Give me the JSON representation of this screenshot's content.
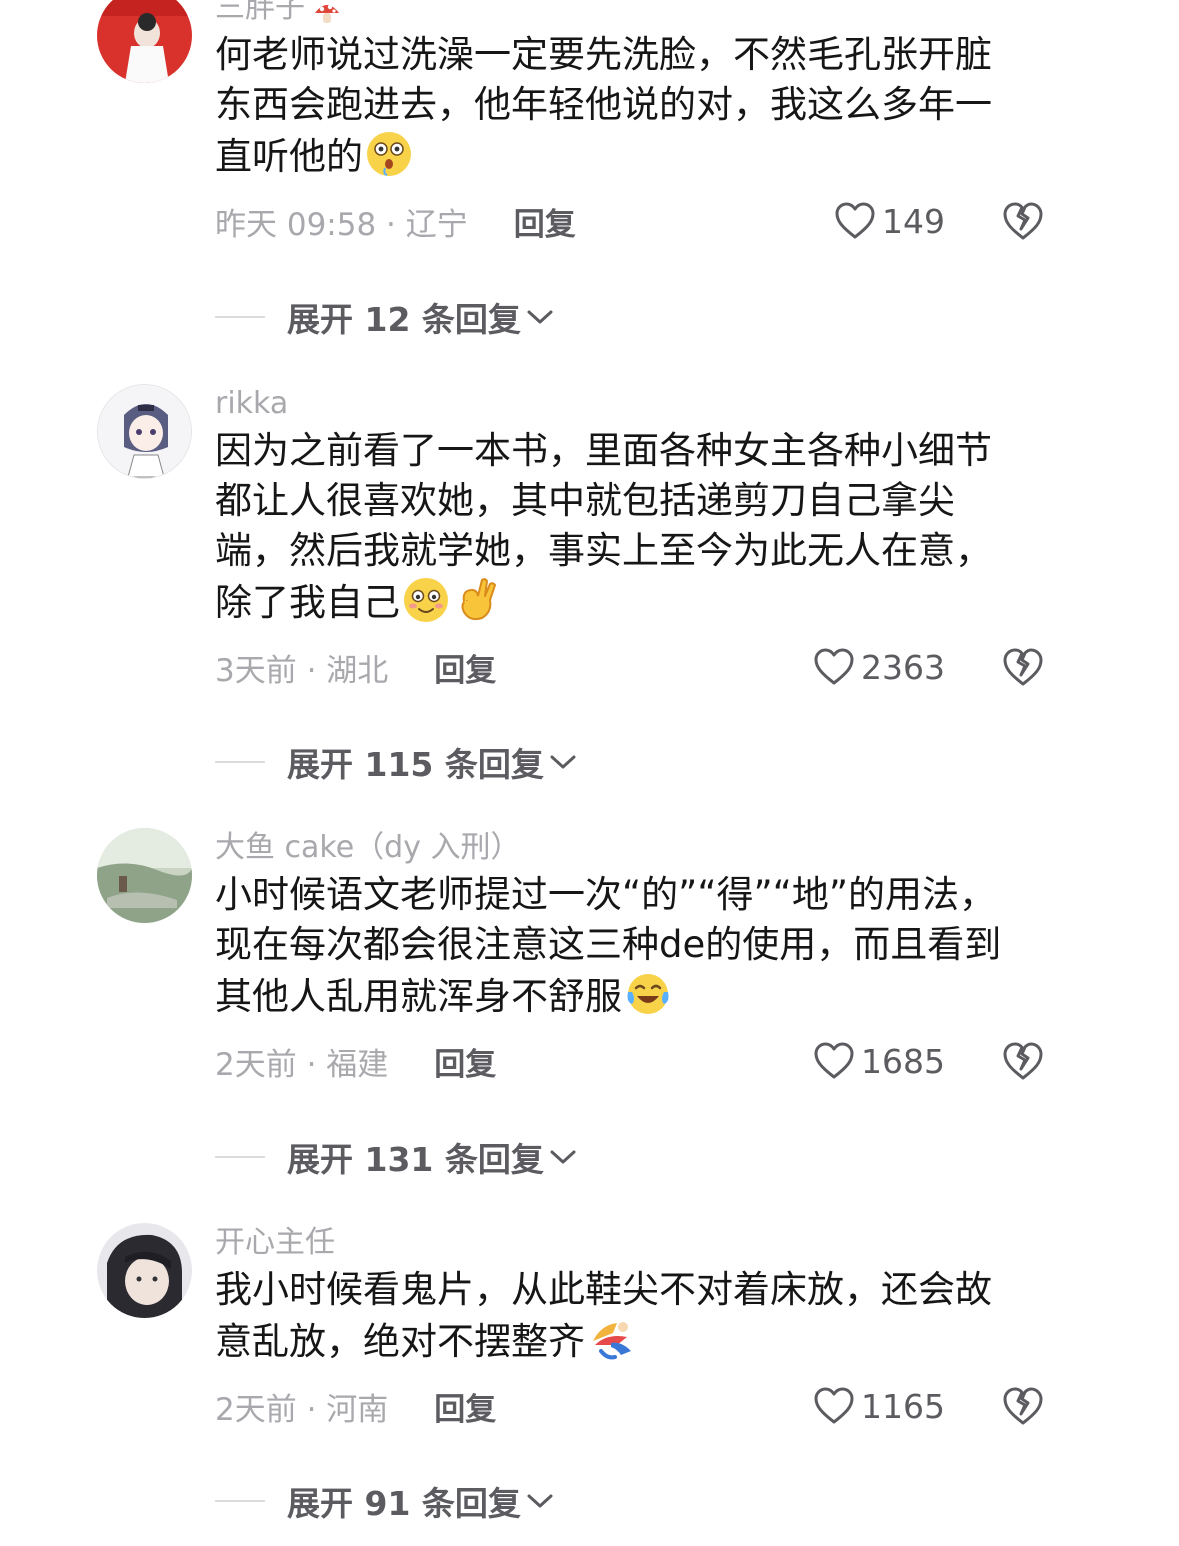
{
  "comments": [
    {
      "username": "三胖子",
      "text": "何老师说过洗澡一定要先洗脸，不然毛孔张开脏东西会跑进去，他年轻他说的对，我这么多年一直听他的",
      "emojis": [
        "shocked-face-emoji"
      ],
      "time_location": "昨天 09:58 · 辽宁",
      "reply_label": "回复",
      "likes": "149",
      "expand_label": "展开 12 条回复",
      "avatar_color": "#d9312b"
    },
    {
      "username": "rikka",
      "text": "因为之前看了一本书，里面各种女主各种小细节都让人很喜欢她，其中就包括递剪刀自己拿尖端，然后我就学她，事实上至今为此无人在意，除了我自己",
      "emojis": [
        "blushing-face-emoji",
        "ok-hand-emoji"
      ],
      "time_location": "3天前 · 湖北",
      "reply_label": "回复",
      "likes": "2363",
      "expand_label": "展开 115 条回复",
      "avatar_color": "#f4f4f6"
    },
    {
      "username": "大鱼 cake（dy 入刑）",
      "text": "小时候语文老师提过一次“的”“得”“地”的用法，现在每次都会很注意这三种de的使用，而且看到其他人乱用就浑身不舒服",
      "emojis": [
        "tears-of-joy-emoji"
      ],
      "time_location": "2天前 · 福建",
      "reply_label": "回复",
      "likes": "1685",
      "expand_label": "展开 131 条回复",
      "avatar_color": "#9fae9a"
    },
    {
      "username": "开心主任",
      "text": "我小时候看鬼片，从此鞋尖不对着床放，还会故意乱放，绝对不摆整齐",
      "emojis": [
        "running-figure-emoji"
      ],
      "time_location": "2天前 · 河南",
      "reply_label": "回复",
      "likes": "1165",
      "expand_label": "展开 91 条回复",
      "avatar_color": "#3a3a40"
    }
  ],
  "colors": {
    "meta_gray": "#a8a8ad",
    "action_gray": "#5b5b60",
    "text": "#161616"
  }
}
